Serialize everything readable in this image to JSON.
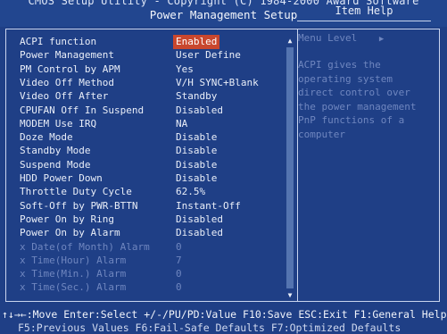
{
  "header": {
    "line1": "CMOS Setup Utility - Copyright (C) 1984-2000 Award Software",
    "line2": "Power Management Setup"
  },
  "help": {
    "title": "Item Help",
    "menu_level": "Menu Level",
    "menu_level_arrow": "▶",
    "lines": [
      "ACPI gives the",
      "operating system",
      "direct control over",
      "the power management",
      "PnP functions of a",
      "computer"
    ]
  },
  "settings": [
    {
      "label": "ACPI function",
      "value": "Enabled",
      "selected": true,
      "dim": false
    },
    {
      "label": "Power Management",
      "value": "User Define",
      "dim": false
    },
    {
      "label": "PM Control by APM",
      "value": "Yes",
      "dim": false
    },
    {
      "label": "Video Off Method",
      "value": "V/H SYNC+Blank",
      "dim": false
    },
    {
      "label": "Video Off After",
      "value": "Standby",
      "dim": false
    },
    {
      "label": "CPUFAN Off In Suspend",
      "value": "Disabled",
      "dim": false
    },
    {
      "label": "MODEM Use IRQ",
      "value": "NA",
      "dim": false
    },
    {
      "label": "Doze Mode",
      "value": "Disable",
      "dim": false
    },
    {
      "label": "Standby Mode",
      "value": "Disable",
      "dim": false
    },
    {
      "label": "Suspend Mode",
      "value": "Disable",
      "dim": false
    },
    {
      "label": "HDD Power Down",
      "value": "Disable",
      "dim": false
    },
    {
      "label": "Throttle Duty Cycle",
      "value": "62.5%",
      "dim": false
    },
    {
      "label": "Soft-Off by PWR-BTTN",
      "value": "Instant-Off",
      "dim": false
    },
    {
      "label": "Power On by Ring",
      "value": "Disabled",
      "dim": false
    },
    {
      "label": "Power On by Alarm",
      "value": "Disabled",
      "dim": false
    },
    {
      "label": "x Date(of Month) Alarm",
      "value": "0",
      "dim": true
    },
    {
      "label": "x Time(Hour) Alarm",
      "value": "7",
      "dim": true
    },
    {
      "label": "x Time(Min.) Alarm",
      "value": "0",
      "dim": true
    },
    {
      "label": "x Time(Sec.) Alarm",
      "value": "0",
      "dim": true
    }
  ],
  "footer": {
    "line1": "↑↓→←:Move  Enter:Select  +/-/PU/PD:Value  F10:Save  ESC:Exit  F1:General Help",
    "line2": "F5:Previous Values   F6:Fail-Safe Defaults   F7:Optimized Defaults"
  },
  "colors": {
    "background": "#1f3f86",
    "selected": "#c9472e",
    "dim_text": "#6f86bf",
    "text": "#e9eef8"
  }
}
